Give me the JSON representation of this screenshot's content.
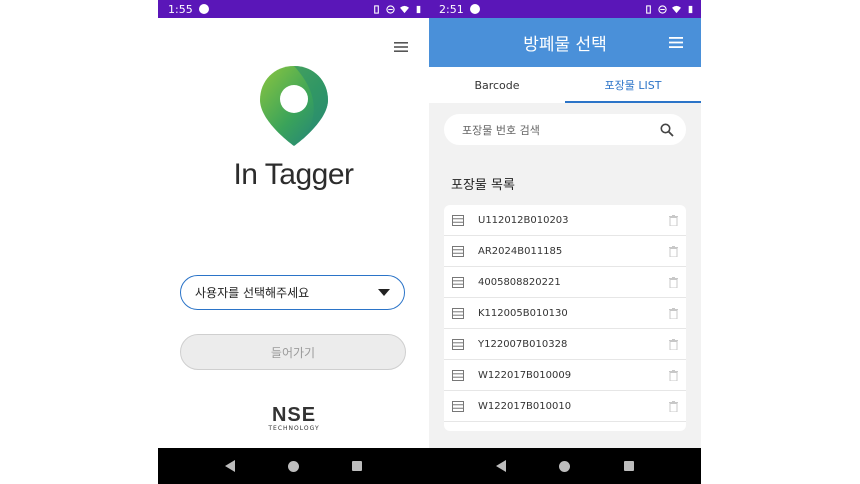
{
  "left": {
    "status": {
      "time": "1:55"
    },
    "brand": "In Tagger",
    "user_select": {
      "value": "사용자를 선택해주세요"
    },
    "enter_label": "들어가기",
    "company": {
      "name": "NSE",
      "tagline": "TECHNOLOGY"
    }
  },
  "right": {
    "status": {
      "time": "2:51"
    },
    "appbar": {
      "title": "방폐물 선택"
    },
    "tabs": [
      {
        "label": "Barcode"
      },
      {
        "label": "포장물 LIST"
      }
    ],
    "active_tab": "포장물 LIST",
    "search": {
      "placeholder": "포장물 번호 검색"
    },
    "section_title": "포장물 목록",
    "items": [
      {
        "code": "U112012B010203"
      },
      {
        "code": "AR2024B011185"
      },
      {
        "code": "4005808820221"
      },
      {
        "code": "K112005B010130"
      },
      {
        "code": "Y122007B010328"
      },
      {
        "code": "W122017B010009"
      },
      {
        "code": "W122017B010010"
      }
    ]
  },
  "colors": {
    "status_bar": "#5a16b8",
    "app_bar": "#4a90d9",
    "accent": "#2b74c8",
    "nav_bar": "#000000"
  },
  "icons": [
    "menu-icon",
    "search-icon",
    "document-icon",
    "trash-icon",
    "dropdown-caret-icon",
    "location-pin-logo"
  ]
}
